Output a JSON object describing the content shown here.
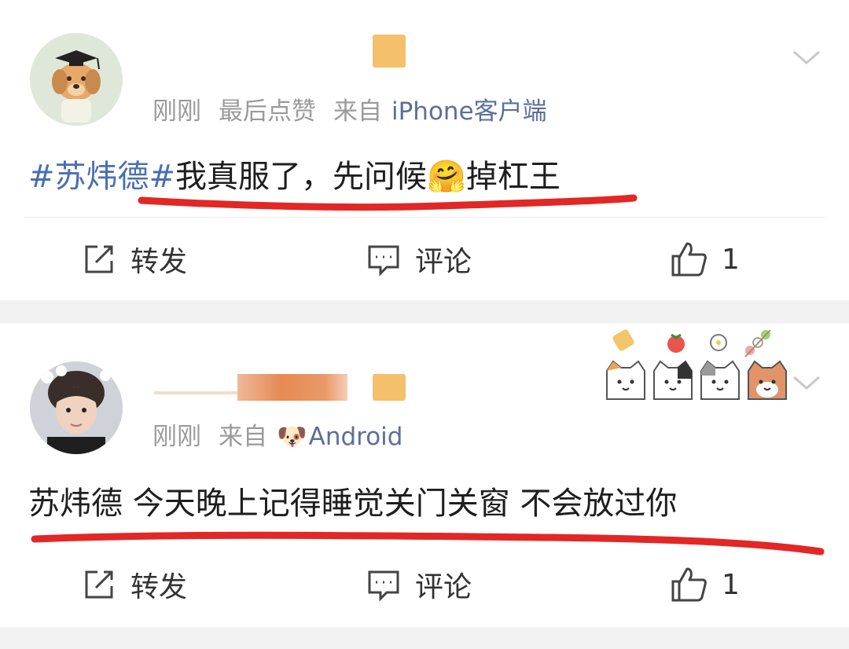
{
  "posts": [
    {
      "time": "刚刚",
      "extra": "最后点赞",
      "from_label": "来自",
      "source": "iPhone客户端",
      "content_topic": "#苏炜德#",
      "content_before": "我真服了，先问候",
      "content_emoji": "🤗",
      "content_after": "掉杠王",
      "actions": {
        "repost": "转发",
        "comment": "评论",
        "like": "1"
      }
    },
    {
      "time": "刚刚",
      "from_label": "来自",
      "source_emoji": "🐶",
      "source": "Android",
      "content": "苏炜德 今天晚上记得睡觉关门关窗 不会放过你",
      "actions": {
        "repost": "转发",
        "comment": "评论",
        "like": "1"
      }
    }
  ],
  "colors": {
    "accent_link": "#4a6fb0",
    "source_blue": "#5b6f99",
    "underline_red": "#e32626",
    "meta_gray": "#9a9a9a"
  },
  "icons": [
    "chevron-down-icon",
    "repost-icon",
    "comment-icon",
    "like-icon"
  ]
}
